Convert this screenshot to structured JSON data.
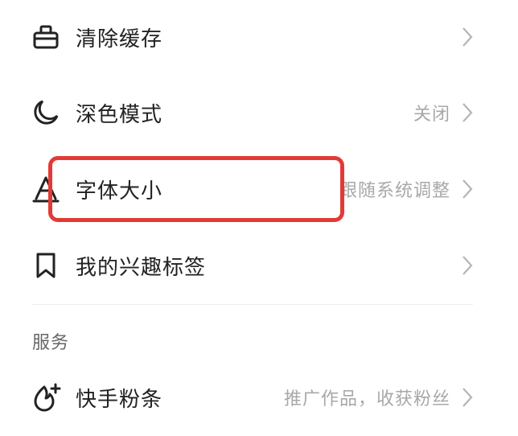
{
  "settings": {
    "items": [
      {
        "label": "清除缓存",
        "value": "",
        "icon": "cleaning-icon"
      },
      {
        "label": "深色模式",
        "value": "关闭",
        "icon": "moon-icon"
      },
      {
        "label": "字体大小",
        "value": "跟随系统调整",
        "icon": "font-size-icon"
      },
      {
        "label": "我的兴趣标签",
        "value": "",
        "icon": "bookmark-icon"
      }
    ]
  },
  "services": {
    "title": "服务",
    "items": [
      {
        "label": "快手粉条",
        "value": "推广作品，收获粉丝",
        "icon": "flame-plus-icon"
      }
    ]
  },
  "colors": {
    "highlight": "#e33a36",
    "text": "#222222",
    "secondary": "#a8a8a8"
  }
}
